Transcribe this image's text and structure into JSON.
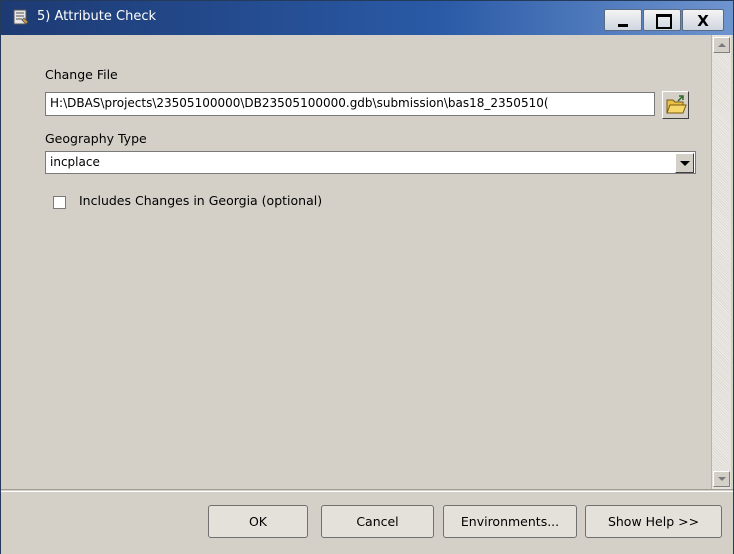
{
  "window": {
    "title": "5) Attribute Check",
    "minimize_label": "_",
    "close_label": "X"
  },
  "form": {
    "change_file_label": "Change File",
    "change_file_value": "H:\\DBAS\\projects\\23505100000\\DB23505100000.gdb\\submission\\bas18_2350510(",
    "geography_type_label": "Geography Type",
    "geography_type_value": "incplace",
    "georgia_checkbox_label": "Includes Changes in Georgia (optional)",
    "georgia_checked": false
  },
  "buttons": {
    "ok": "OK",
    "cancel": "Cancel",
    "environments": "Environments...",
    "show_help": "Show Help >>"
  },
  "icons": {
    "app": "toolbox-script-icon",
    "browse": "open-folder-icon"
  }
}
